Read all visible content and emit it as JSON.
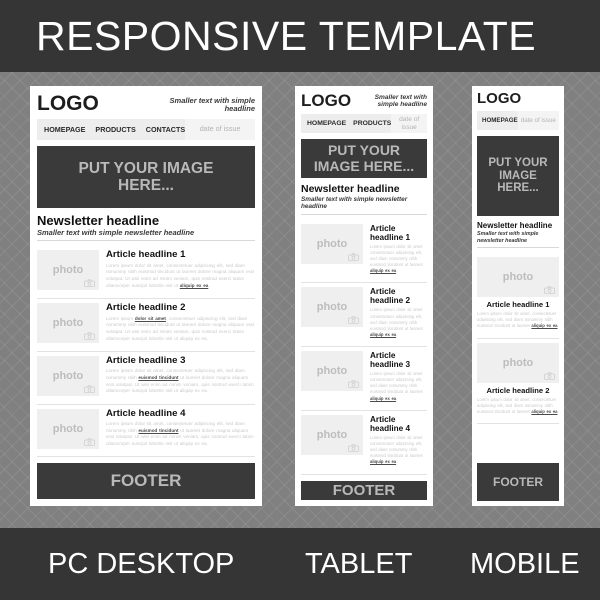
{
  "header": {
    "title": "RESPONSIVE TEMPLATE"
  },
  "footer_labels": {
    "desktop": "PC DESKTOP",
    "tablet": "TABLET",
    "mobile": "MOBILE"
  },
  "common": {
    "logo": "LOGO",
    "tagline": "Smaller text with simple headline",
    "date_of_issue": "date of issue",
    "hero_text": "PUT YOUR IMAGE HERE...",
    "newsletter_headline": "Newsletter headline",
    "newsletter_sub": "Smaller text with simple newsletter headline",
    "photo_placeholder": "photo",
    "footer_text": "FOOTER",
    "camera_icon": "camera-icon",
    "nav_homepage": "HOMEPAGE",
    "nav_products": "PRODUCTS",
    "nav_contacts": "CONTACTS"
  },
  "desktop": {
    "label": "PC DESKTOP",
    "nav": [
      "HOMEPAGE",
      "PRODUCTS",
      "CONTACTS"
    ],
    "articles": [
      {
        "headline": "Article headline 1",
        "before": "Lorem ipsum dolor sit amet, consectetuer adipiscing elit, sed diam nonummy nibh euismod tincidunt ut laoreet dolore magna aliquam erat volutpat. Ut wisi enim ad minim veniam, quis nostrud exerci tation ullamcorper suscipit lobortis nisl ut ",
        "link": "aliquip ex ea",
        "after": "."
      },
      {
        "headline": "Article headline 2",
        "before": "Lorem ipsum ",
        "link": "dolor sit amet",
        "after": ", consectetuer adipiscing elit, sed diam nonummy nibh euismod tincidunt ut laoreet dolore magna aliquam erat volutpat. Ut wisi enim ad minim veniam, quis nostrud exerci tation ullamcorper suscipit lobortis nisl ut aliquip ex ea."
      },
      {
        "headline": "Article headline 3",
        "before": "Lorem ipsum dolor sit amet, consectetuer adipiscing elit, sed diam nonummy nibh ",
        "link": "euismod tincidunt",
        "after": " ut laoreet dolore magna aliquam erat volutpat. Ut wisi enim ad minim veniam, quis nostrud exerci tation ullamcorper suscipit lobortis nisl ut aliquip ex ea."
      },
      {
        "headline": "Article headline 4",
        "before": "Lorem ipsum dolor sit amet, consectetuer adipiscing elit, sed diam nonummy nibh ",
        "link": "euismod tincidunt",
        "after": " ut laoreet dolore magna aliquam erat volutpat. Ut wisi enim ad minim veniam, quis nostrud exerci tation ullamcorper suscipit lobortis nisl ut aliquip ex ea."
      }
    ]
  },
  "tablet": {
    "label": "TABLET",
    "nav": [
      "HOMEPAGE",
      "PRODUCTS"
    ],
    "articles": [
      {
        "headline": "Article headline 1",
        "before": "Lorem ipsum dolor sit amet consectetuer adipiscing elit, sed diam nonummy nibh euismod tincidunt ut laoreet ",
        "link": "aliquip ex ea",
        "after": "."
      },
      {
        "headline": "Article headline 2",
        "before": "Lorem ipsum dolor sit amet consectetuer adipiscing elit, sed diam nonummy nibh euismod tincidunt ut laoreet ",
        "link": "aliquip ex ea",
        "after": "."
      },
      {
        "headline": "Article headline 3",
        "before": "Lorem ipsum dolor sit amet consectetuer adipiscing elit, sed diam nonummy nibh euismod tincidunt ut laoreet ",
        "link": "aliquip ex ea",
        "after": "."
      },
      {
        "headline": "Article headline 4",
        "before": "Lorem ipsum dolor sit amet consectetuer adipiscing elit, sed diam nonummy nibh euismod tincidunt ut laoreet ",
        "link": "aliquip ex ea",
        "after": "."
      }
    ]
  },
  "mobile": {
    "label": "MOBILE",
    "nav": [
      "HOMEPAGE"
    ],
    "articles": [
      {
        "headline": "Article headline 1",
        "before": "Lorem ipsum dolor sit amet, consectetuer adipiscing elit, sed diam nonummy nibh euismod tincidunt ut laoreet ",
        "link": "aliquip ex ea",
        "after": "."
      },
      {
        "headline": "Article headline 2",
        "before": "Lorem ipsum dolor sit amet, consectetuer adipiscing elit, sed diam nonummy nibh euismod tincidunt ut laoreet ",
        "link": "aliquip ex ea",
        "after": "."
      }
    ]
  },
  "colors": {
    "dark": "#353535",
    "panel_dark": "#3a3a3a",
    "background": "#808080",
    "placeholder_text": "#b9b9b9"
  }
}
